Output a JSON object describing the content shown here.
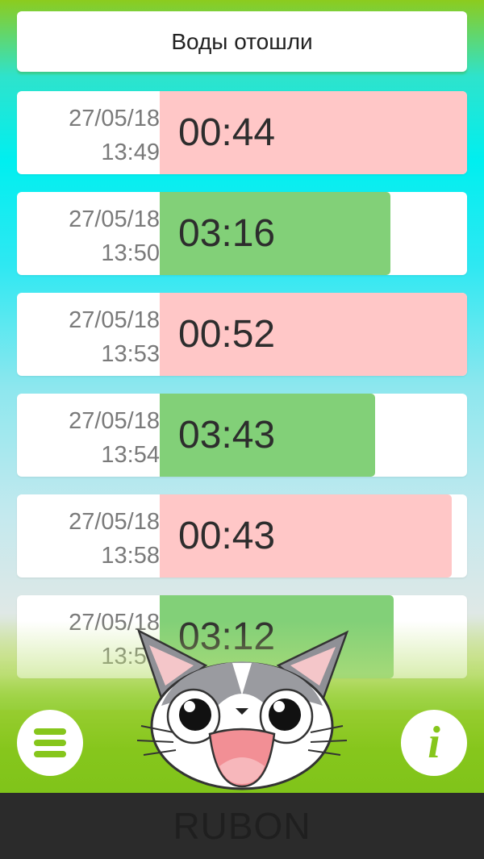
{
  "header": {
    "title": "Воды отошли"
  },
  "rows": [
    {
      "date": "27/05/18",
      "time": "13:49",
      "duration": "00:44",
      "type": "pink",
      "fill": 1.0
    },
    {
      "date": "27/05/18",
      "time": "13:50",
      "duration": "03:16",
      "type": "green",
      "fill": 0.75
    },
    {
      "date": "27/05/18",
      "time": "13:53",
      "duration": "00:52",
      "type": "pink",
      "fill": 1.0
    },
    {
      "date": "27/05/18",
      "time": "13:54",
      "duration": "03:43",
      "type": "green",
      "fill": 0.7
    },
    {
      "date": "27/05/18",
      "time": "13:58",
      "duration": "00:43",
      "type": "pink",
      "fill": 0.95
    },
    {
      "date": "27/05/18",
      "time": "13:59",
      "duration": "03:12",
      "type": "green",
      "fill": 0.76
    }
  ],
  "buttons": {
    "menu_icon": "menu-icon",
    "info_icon": "info-icon",
    "info_glyph": "i"
  },
  "mascot": {
    "icon": "cat-mascot"
  },
  "footer": {
    "brand": "RUBON"
  },
  "colors": {
    "pink": "#ffc7c7",
    "green": "#82d078",
    "accent": "#86c61c"
  }
}
